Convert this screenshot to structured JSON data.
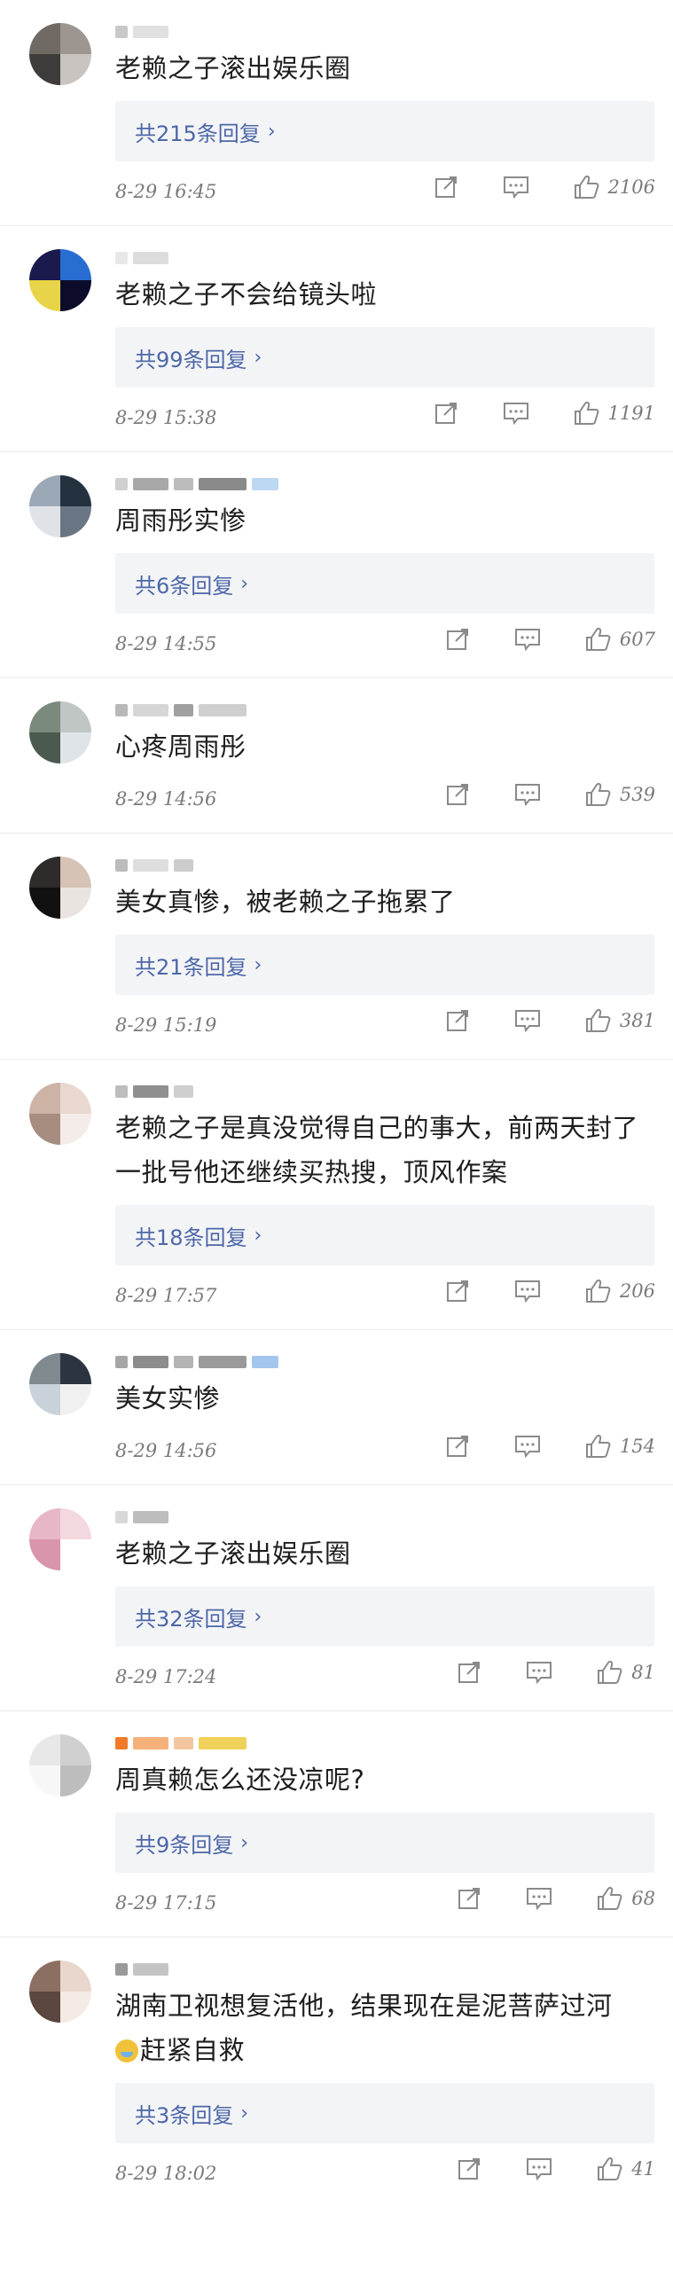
{
  "comments": [
    {
      "text": "老赖之子滚出娱乐圈",
      "replies": "共215条回复",
      "date": "8-29 16:45",
      "likes": "2106",
      "avatar_colors": [
        "#6f6a63",
        "#9d9690",
        "#3e3c3a",
        "#c9c4bf"
      ],
      "name_colors": [
        "#c8c8c8",
        "#e0e0e0"
      ]
    },
    {
      "text": "老赖之子不会给镜头啦",
      "replies": "共99条回复",
      "date": "8-29 15:38",
      "likes": "1191",
      "avatar_colors": [
        "#1b1a4d",
        "#2a6dd1",
        "#e8d448",
        "#0c0c2a"
      ],
      "name_colors": [
        "#e8e8e8",
        "#dcdcdc"
      ]
    },
    {
      "text": "周雨彤实惨",
      "replies": "共6条回复",
      "date": "8-29 14:55",
      "likes": "607",
      "avatar_colors": [
        "#9aa7b5",
        "#24323f",
        "#dfe3e8",
        "#6a7683"
      ],
      "name_colors": [
        "#d0d0d0",
        "#a8a8a8",
        "#bcbcbc",
        "#8a8a8a",
        "#bcd8f3"
      ]
    },
    {
      "text": "心疼周雨彤",
      "replies": "",
      "date": "8-29 14:56",
      "likes": "539",
      "avatar_colors": [
        "#7a8a7c",
        "#bfc6c4",
        "#4a5a4e",
        "#dfe4e8"
      ],
      "name_colors": [
        "#b8b8b8",
        "#d6d6d6",
        "#a0a0a0",
        "#cfcfcf"
      ]
    },
    {
      "text": "美女真惨，被老赖之子拖累了",
      "replies": "共21条回复",
      "date": "8-29 15:19",
      "likes": "381",
      "avatar_colors": [
        "#2e2b2a",
        "#d6c3b5",
        "#111111",
        "#e9e4e0"
      ],
      "name_colors": [
        "#bbbbbb",
        "#dedede",
        "#cccccc"
      ]
    },
    {
      "text": "老赖之子是真没觉得自己的事大，前两天封了一批号他还继续买热搜，顶风作案",
      "replies": "共18条回复",
      "date": "8-29 17:57",
      "likes": "206",
      "avatar_colors": [
        "#cdb3a6",
        "#e8d8d0",
        "#a78c80",
        "#f3ece8"
      ],
      "name_colors": [
        "#bdbdbd",
        "#8f8f8f",
        "#cfcfcf"
      ]
    },
    {
      "text": "美女实惨",
      "replies": "",
      "date": "8-29 14:56",
      "likes": "154",
      "avatar_colors": [
        "#7f8a8f",
        "#2b3440",
        "#c9d2d8",
        "#f0f0f0"
      ],
      "name_colors": [
        "#a6a6a6",
        "#8c8c8c",
        "#b4b4b4",
        "#9a9a9a",
        "#a3c6ec"
      ]
    },
    {
      "text": "老赖之子滚出娱乐圈",
      "replies": "共32条回复",
      "date": "8-29 17:24",
      "likes": "81",
      "avatar_colors": [
        "#e7b7c7",
        "#f4d8e0",
        "#d895ab",
        "#ffffff"
      ],
      "name_colors": [
        "#d8d8d8",
        "#bdbdbd"
      ]
    },
    {
      "text": "周真赖怎么还没凉呢?",
      "replies": "共9条回复",
      "date": "8-29 17:15",
      "likes": "68",
      "avatar_colors": [
        "#e8e8e8",
        "#d0d0d0",
        "#f7f7f7",
        "#bdbdbd"
      ],
      "name_colors": [
        "#f07a2a",
        "#f6b07a",
        "#f4c6a0",
        "#f0d15a"
      ]
    },
    {
      "text": "湖南卫视想复活他，结果现在是泥菩萨过河",
      "emoji_line": "赶紧自救",
      "replies": "共3条回复",
      "date": "8-29 18:02",
      "likes": "41",
      "avatar_colors": [
        "#8a6f62",
        "#e9d6cc",
        "#5a463e",
        "#f4ebe6"
      ],
      "name_colors": [
        "#9a9a9a",
        "#c4c4c4"
      ]
    }
  ],
  "icons": {
    "share": "share-icon",
    "comment": "comment-icon",
    "like": "like-icon"
  },
  "colors": {
    "reply_link": "#4d67a8",
    "reply_bg": "#f3f4f6",
    "meta": "#7a7a7a"
  }
}
